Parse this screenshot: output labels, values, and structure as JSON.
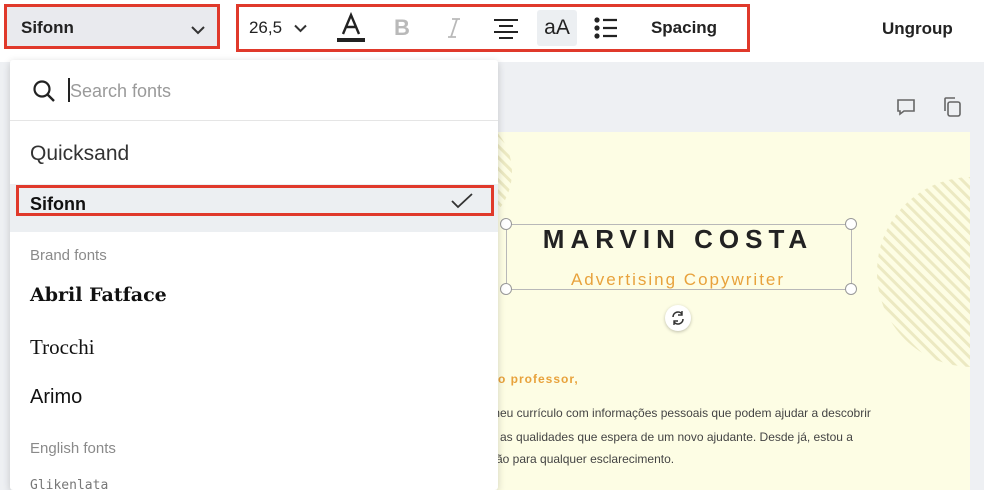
{
  "toolbar": {
    "font_name": "Sifonn",
    "font_size": "26,5",
    "spacing_label": "Spacing",
    "ungroup_label": "Ungroup",
    "case_label": "aA"
  },
  "search": {
    "placeholder": "Search fonts"
  },
  "fonts": {
    "recent": [
      "Quicksand",
      "Sifonn"
    ],
    "selected": "Sifonn",
    "brand_heading": "Brand fonts",
    "brand": [
      "Abril Fatface",
      "Trocchi",
      "Arimo"
    ],
    "english_heading": "English fonts",
    "english_partial": "Glikenlata"
  },
  "document": {
    "name": "MARVIN COSTA",
    "role": "Advertising Copywriter",
    "greeting": "ado professor,",
    "body_lines": [
      "meu currículo com informações pessoais que podem ajudar a descobrir",
      "o as qualidades que espera de um novo ajudante. Desde já, estou a",
      "ção para qualquer esclarecimento."
    ]
  },
  "colors": {
    "highlight": "#e0392b",
    "page_bg": "#fdfde4",
    "accent": "#e8a23c"
  }
}
